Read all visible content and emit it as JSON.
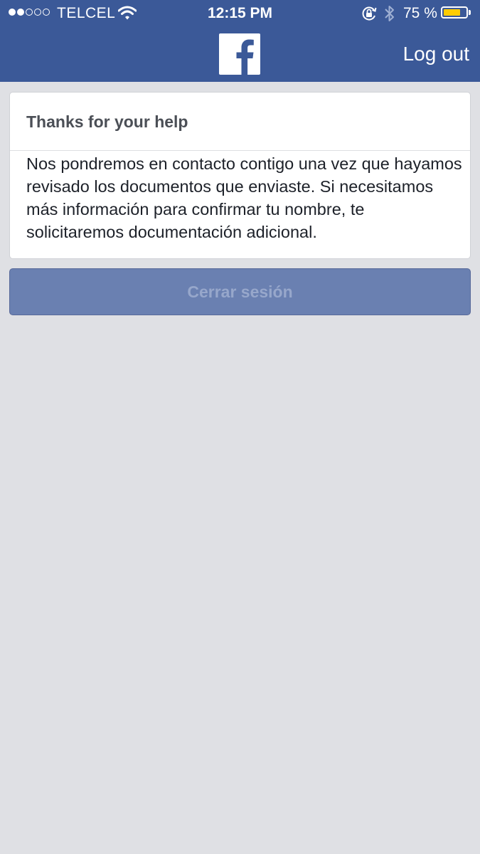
{
  "status_bar": {
    "signal_dots_filled": 2,
    "signal_dots_total": 5,
    "carrier": "TELCEL",
    "time": "12:15 PM",
    "battery_percent": "75 %",
    "battery_level": 0.75
  },
  "header": {
    "logo": "facebook-f-logo",
    "logout_label": "Log out"
  },
  "card": {
    "title": "Thanks for your help",
    "body": "Nos pondremos en contacto contigo una vez que hayamos revisado los documentos que enviaste. Si necesitamos más información para confirmar tu nombre, te solicitaremos documentación adicional."
  },
  "button": {
    "label": "Cerrar sesión"
  },
  "colors": {
    "brand": "#3b5998",
    "background": "#dfe0e4",
    "button_disabled": "#6a80b1",
    "battery_fill": "#ffcc00"
  }
}
